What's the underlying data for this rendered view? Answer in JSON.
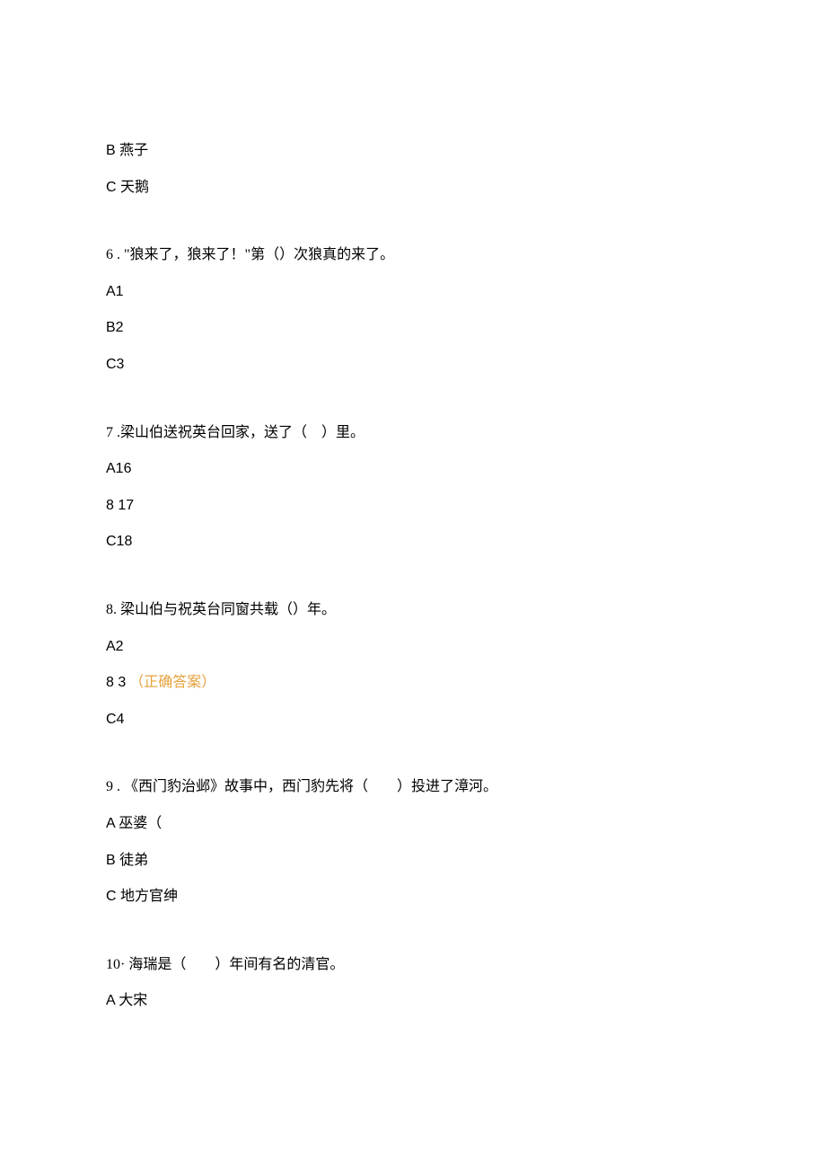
{
  "q5_options": {
    "b": "B 燕子",
    "c": "C 天鹅"
  },
  "q6": {
    "number": "6",
    "text": ". \"狼来了，狼来了！\"第（）次狼真的来了。",
    "options": {
      "a": "A1",
      "b": "B2",
      "c": "C3"
    }
  },
  "q7": {
    "number": "7",
    "text": ".梁山伯送祝英台回家，送了（　）里。",
    "options": {
      "a": "A16",
      "b": "8   17",
      "c": "C18"
    }
  },
  "q8": {
    "number": "8.",
    "text": "梁山伯与祝英台同窗共载（）年。",
    "options": {
      "a": "A2",
      "b_prefix": "8   3",
      "b_correct": "（正确答案）",
      "c": "C4"
    }
  },
  "q9": {
    "number": "9",
    "text": ". 《西门豹治邺》故事中，西门豹先将（　　）投进了漳河。",
    "options": {
      "a": "A 巫婆（",
      "b": "B 徒弟",
      "c": "C 地方官绅"
    }
  },
  "q10": {
    "number": "10·",
    "text": "海瑞是（　　）年间有名的清官。",
    "options": {
      "a": "A 大宋"
    }
  }
}
